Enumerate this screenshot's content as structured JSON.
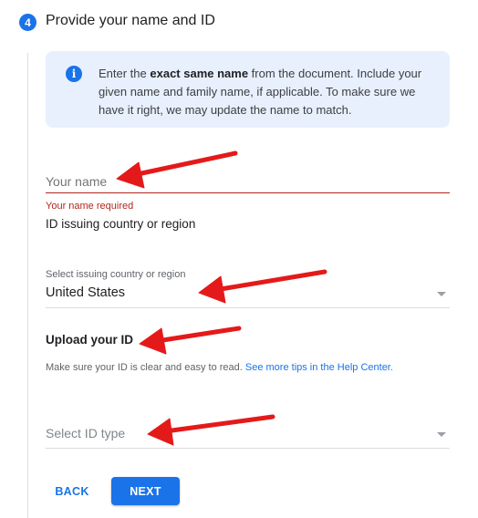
{
  "step": {
    "number": "4",
    "title": "Provide your name and ID"
  },
  "info": {
    "icon": "info-icon",
    "text_prefix": "Enter the ",
    "text_bold": "exact same name",
    "text_suffix": " from the document. Include your given name and family name, if applicable. To make sure we have it right, we may update the name to match."
  },
  "name_field": {
    "placeholder": "Your name",
    "error": "Your name required"
  },
  "region_label": "ID issuing country or region",
  "country_select": {
    "caption": "Select issuing country or region",
    "value": "United States"
  },
  "upload": {
    "title": "Upload your ID",
    "hint_text": "Make sure your ID is clear and easy to read. ",
    "hint_link": "See more tips in the Help Center."
  },
  "id_type_select": {
    "placeholder": "Select ID type"
  },
  "buttons": {
    "back": "BACK",
    "next": "NEXT"
  },
  "colors": {
    "accent": "#1a73e8",
    "error": "#b3261e",
    "info_bg": "#e8f0fe",
    "annotation_arrow": "#e41a1a"
  }
}
